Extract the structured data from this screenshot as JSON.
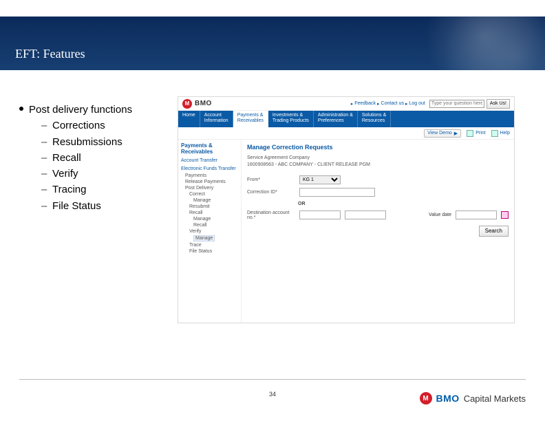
{
  "banner": {
    "title": "EFT: Features"
  },
  "bullets": {
    "heading": "Post delivery functions",
    "items": [
      "Corrections",
      "Resubmissions",
      "Recall",
      "Verify",
      "Tracing",
      "File Status"
    ]
  },
  "app": {
    "logo": {
      "mark": "M",
      "text": "BMO"
    },
    "topLinks": {
      "feedback": "Feedback",
      "contact": "Contact us",
      "logout": "Log out"
    },
    "ask": {
      "placeholder": "Type your question here",
      "button": "Ask Us!"
    },
    "nav": {
      "home": "Home",
      "acct": "Account\nInformation",
      "pay": "Payments &\nReceivables",
      "inv": "Investments &\nTrading Products",
      "admin": "Administration &\nPreferences",
      "sol": "Solutions &\nResources"
    },
    "util": {
      "demo": "View Demo",
      "print": "Print",
      "help": "Help"
    },
    "side": {
      "title": "Payments & Receivables",
      "acctTransfer": "Account Transfer",
      "eft": "Electronic Funds Transfer",
      "items": {
        "payments": "Payments",
        "release": "Release Payments",
        "postdel": "Post Delivery",
        "correct": "Correct",
        "manage": "Manage",
        "resubmit": "Resubmit",
        "recall": "Recall",
        "manage2": "Manage",
        "recall2": "Recall",
        "verify": "Verify",
        "selected": "Manage",
        "trace": "Trace",
        "filestatus": "File Status"
      }
    },
    "main": {
      "heading": "Manage Correction Requests",
      "svcLabel": "Service Agreement Company",
      "svcValue": "1600908563 - ABC COMPANY - CLIENT RELEASE PGM",
      "fromLabel": "From*",
      "fromValue": "KG 1",
      "corrLabel": "Correction ID*",
      "or": "OR",
      "destLabel": "Destination account no.*",
      "valueDateLabel": "Value date",
      "searchBtn": "Search"
    }
  },
  "footer": {
    "page": "34",
    "logo": {
      "mark": "M",
      "bmo": "BMO",
      "cm": "Capital Markets"
    }
  }
}
